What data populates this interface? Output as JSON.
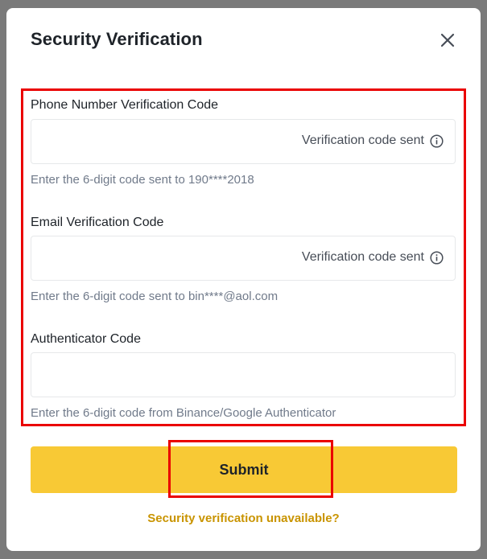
{
  "dialog": {
    "title": "Security Verification",
    "close_icon": "close-icon"
  },
  "phone": {
    "label": "Phone Number Verification Code",
    "value": "",
    "status": "Verification code sent",
    "status_icon": "info-icon",
    "helper": "Enter the 6-digit code sent to 190****2018"
  },
  "email": {
    "label": "Email Verification Code",
    "value": "",
    "status": "Verification code sent",
    "status_icon": "info-icon",
    "helper": "Enter the 6-digit code sent to bin****@aol.com"
  },
  "authenticator": {
    "label": "Authenticator Code",
    "value": "",
    "helper": "Enter the 6-digit code from Binance/Google Authenticator"
  },
  "actions": {
    "submit_label": "Submit",
    "unavailable_label": "Security verification unavailable?"
  },
  "colors": {
    "accent": "#F8C935",
    "link": "#C99400",
    "highlight": "#EA0000",
    "text": "#1E2329",
    "muted": "#707A8A"
  }
}
